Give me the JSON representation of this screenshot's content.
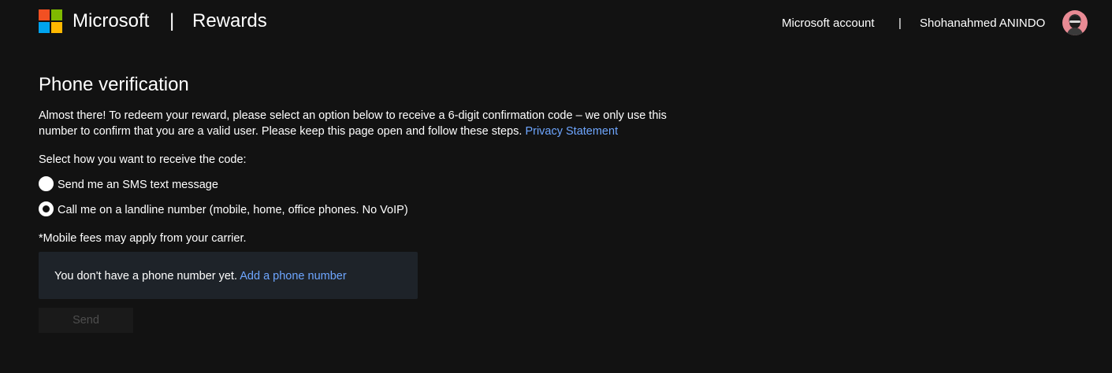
{
  "header": {
    "brand": "Microsoft",
    "separator": "|",
    "product": "Rewards",
    "account_link": "Microsoft account",
    "account_separator": "|",
    "user_name": "Shohanahmed ANINDO",
    "logo_colors": [
      "#f25022",
      "#7fba00",
      "#00a4ef",
      "#ffb900"
    ],
    "avatar_icon": "user-avatar"
  },
  "main": {
    "title": "Phone verification",
    "intro_text": "Almost there! To redeem your reward, please select an option below to receive a 6-digit confirmation code – we only use this number to confirm that you are a valid user. Please keep this page open and follow these steps.",
    "privacy_link": "Privacy Statement",
    "select_label": "Select how you want to receive the code:",
    "options": [
      {
        "label": "Send me an SMS text message",
        "selected": false
      },
      {
        "label": "Call me on a landline number (mobile, home, office phones. No VoIP)",
        "selected": true
      }
    ],
    "fees_note": "*Mobile fees may apply from your carrier.",
    "phone_box_text": "You don't have a phone number yet.",
    "add_phone_link": "Add a phone number",
    "send_label": "Send"
  },
  "colors": {
    "background": "#121212",
    "link": "#6ea6ff",
    "phone_box_bg": "#1e2329",
    "send_disabled_text": "#4e4e4e"
  }
}
